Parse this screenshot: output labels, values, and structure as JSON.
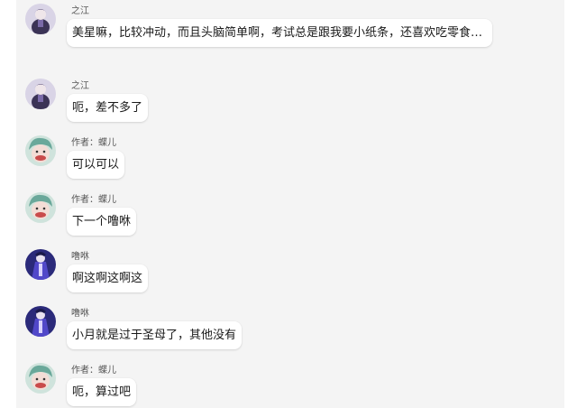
{
  "messages": [
    {
      "sender": "之江",
      "text": "美星嘛，比较冲动，而且头脑简单啊，考试总是跟我要小纸条，还喜欢吃零食…",
      "avatar": "purple-knight-avatar"
    },
    {
      "sender": "之江",
      "text": "呃，差不多了",
      "avatar": "purple-knight-avatar"
    },
    {
      "sender": "作者：蝶儿",
      "text": "可以可以",
      "avatar": "green-haired-face-avatar"
    },
    {
      "sender": "作者：蝶儿",
      "text": "下一个噜咻",
      "avatar": "green-haired-face-avatar"
    },
    {
      "sender": "噜咻",
      "text": "啊这啊这啊这",
      "avatar": "blue-robe-figure-avatar"
    },
    {
      "sender": "噜咻",
      "text": "小月就是过于圣母了，其他没有",
      "avatar": "blue-robe-figure-avatar"
    },
    {
      "sender": "作者：蝶儿",
      "text": "呃，算过吧",
      "avatar": "green-haired-face-avatar"
    }
  ],
  "colors": {
    "panel": "#f4f4f4",
    "bubble": "#ffffff",
    "text": "#1a1a1a",
    "sender": "#555555"
  }
}
